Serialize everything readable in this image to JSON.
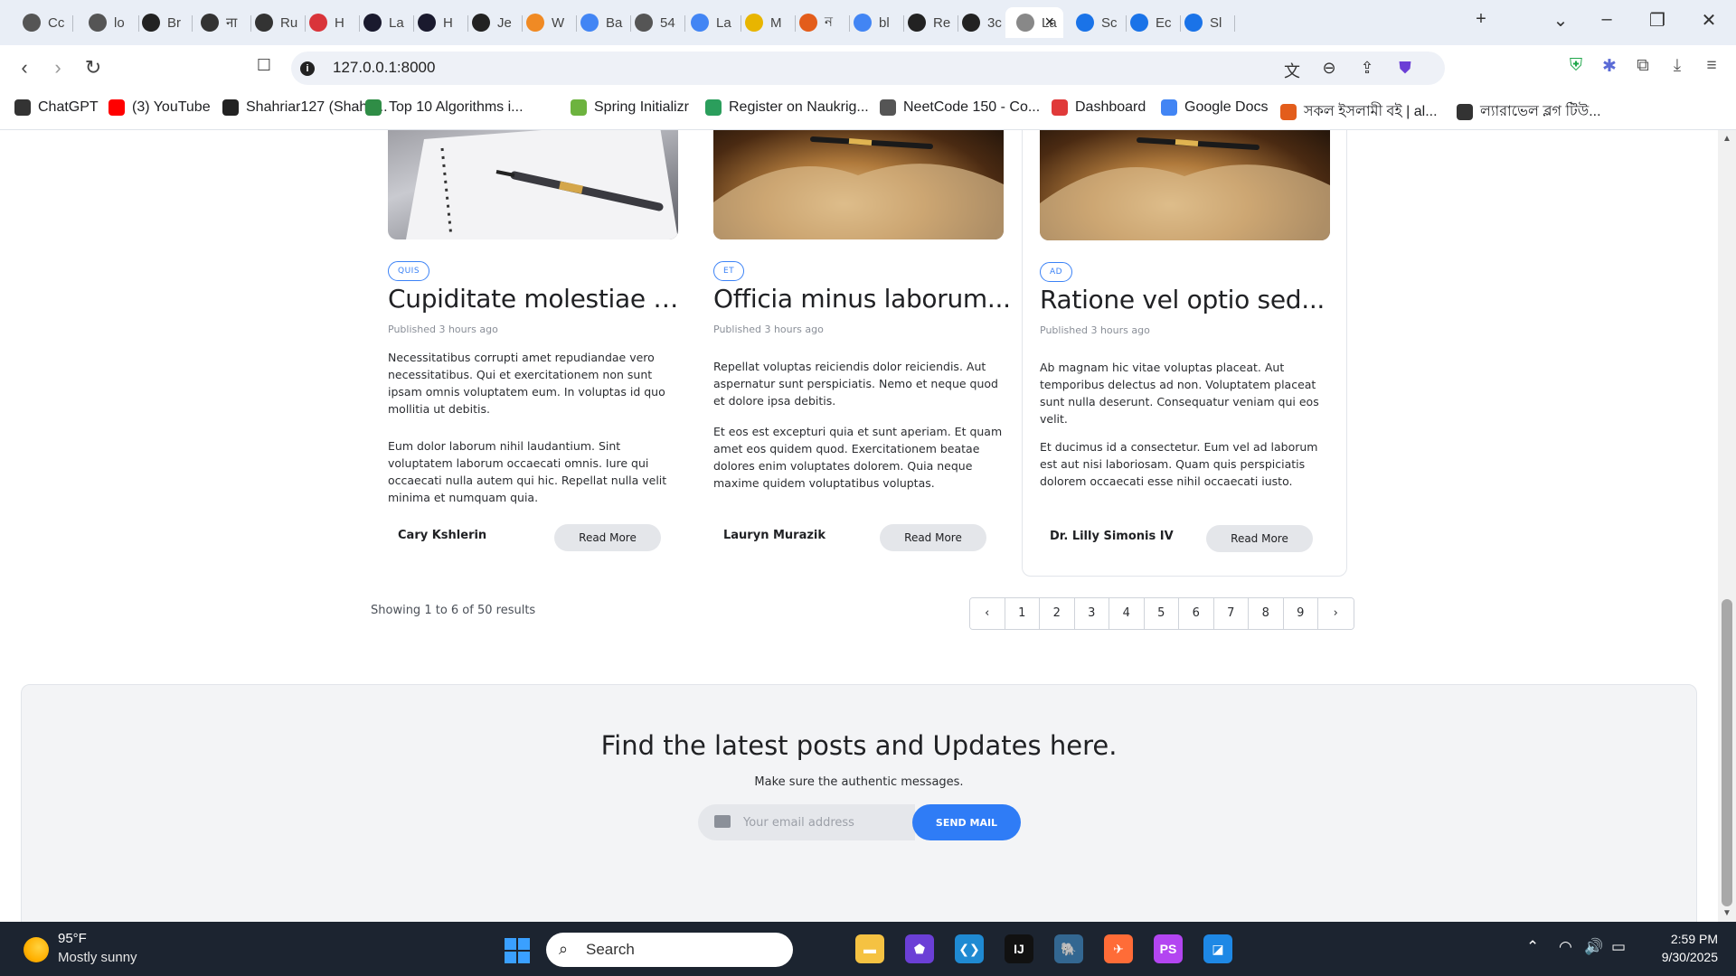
{
  "browser": {
    "tabs": [
      {
        "label": "Cc",
        "icon": "globe-icon",
        "color": "#555555"
      },
      {
        "label": "lo",
        "icon": "openai-icon",
        "color": "#555555"
      },
      {
        "label": "Br",
        "icon": "github-icon",
        "color": "#222222"
      },
      {
        "label": "ना",
        "icon": "openai-icon",
        "color": "#333333"
      },
      {
        "label": "Ru",
        "icon": "openai-icon",
        "color": "#333333"
      },
      {
        "label": "H",
        "icon": "nsu-icon",
        "color": "#d9343a"
      },
      {
        "label": "La",
        "icon": "atcoder-icon",
        "color": "#1a1a2e"
      },
      {
        "label": "H",
        "icon": "atcoder-icon",
        "color": "#1a1a2e"
      },
      {
        "label": "Je",
        "icon": "github-icon",
        "color": "#222222"
      },
      {
        "label": "W",
        "icon": "diamond-icon",
        "color": "#f08a24"
      },
      {
        "label": "Ba",
        "icon": "translate-icon",
        "color": "#4285f4"
      },
      {
        "label": "54",
        "icon": "globe-icon",
        "color": "#555555"
      },
      {
        "label": "La",
        "icon": "docs-icon",
        "color": "#4285f4"
      },
      {
        "label": "M",
        "icon": "medium-icon",
        "color": "#e8b500"
      },
      {
        "label": "ন",
        "icon": "a-icon",
        "color": "#e35d1b"
      },
      {
        "label": "bl",
        "icon": "google-icon",
        "color": "#4285f4"
      },
      {
        "label": "Re",
        "icon": "blocks-icon",
        "color": "#222222"
      },
      {
        "label": "3c",
        "icon": "s-icon",
        "color": "#222222"
      },
      {
        "label": "La",
        "icon": "page-icon",
        "color": "#888888",
        "active": true
      },
      {
        "label": "Sc",
        "icon": "forms-icon",
        "color": "#1a73e8"
      },
      {
        "label": "Ec",
        "icon": "forms-icon",
        "color": "#1a73e8"
      },
      {
        "label": "Sl",
        "icon": "forms-icon",
        "color": "#1a73e8"
      }
    ],
    "url": "127.0.0.1:8000",
    "bookmarks": [
      {
        "label": "ChatGPT",
        "icon": "openai-icon",
        "color": "#333333"
      },
      {
        "label": "(3) YouTube",
        "icon": "youtube-icon",
        "color": "#ff0000"
      },
      {
        "label": "Shahriar127 (Shahri...",
        "icon": "github-icon",
        "color": "#222222"
      },
      {
        "label": "Top 10 Algorithms i...",
        "icon": "gfg-icon",
        "color": "#2f8d46"
      },
      {
        "label": "Spring Initializr",
        "icon": "spring-icon",
        "color": "#6db33f"
      },
      {
        "label": "Register on Naukrig...",
        "icon": "naukri-icon",
        "color": "#2b9e5c"
      },
      {
        "label": "NeetCode 150 - Co...",
        "icon": "rocket-icon",
        "color": "#555555"
      },
      {
        "label": "Dashboard",
        "icon": "dashboard-icon",
        "color": "#e03a3a"
      },
      {
        "label": "Google Docs",
        "icon": "docs-icon",
        "color": "#4285f4"
      },
      {
        "label": "সকল ইসলামী বই | al...",
        "icon": "a-icon",
        "color": "#e35d1b"
      },
      {
        "label": "ল্যারাভেল ব্লগ টিউ...",
        "icon": "openai-icon",
        "color": "#333333"
      }
    ]
  },
  "page": {
    "cards": [
      {
        "image": "notebook-pen",
        "tag": "QUIS",
        "title": "Cupiditate molestiae e...",
        "published": "Published 3 hours ago",
        "paragraphs": [
          "Necessitatibus corrupti amet repudiandae vero necessitatibus. Qui et exercitationem non sunt ipsam omnis voluptatem eum. In voluptas id quo mollitia ut debitis.",
          "Eum dolor laborum nihil laudantium. Sint voluptatem laborum occaecati omnis. Iure qui occaecati nulla autem qui hic. Repellat nulla velit minima et numquam quia."
        ],
        "author": "Cary Kshlerin",
        "read_more": "Read More"
      },
      {
        "image": "open-book",
        "tag": "ET",
        "title": "Officia minus laborum...",
        "published": "Published 3 hours ago",
        "paragraphs": [
          "Repellat voluptas reiciendis dolor reiciendis. Aut aspernatur sunt perspiciatis. Nemo et neque quod et dolore ipsa debitis.",
          "Et eos est excepturi quia et sunt aperiam. Et quam amet eos quidem quod. Exercitationem beatae dolores enim voluptates dolorem. Quia neque maxime quidem voluptatibus voluptas."
        ],
        "author": "Lauryn Murazik",
        "read_more": "Read More"
      },
      {
        "image": "open-book",
        "tag": "AD",
        "title": "Ratione vel optio sed...",
        "published": "Published 3 hours ago",
        "paragraphs": [
          "Ab magnam hic vitae voluptas placeat. Aut temporibus delectus ad non. Voluptatem placeat sunt nulla deserunt. Consequatur veniam qui eos velit.",
          "Et ducimus id a consectetur. Eum vel ad laborum est aut nisi laboriosam. Quam quis perspiciatis dolorem occaecati esse nihil occaecati iusto."
        ],
        "author": "Dr. Lilly Simonis IV",
        "read_more": "Read More"
      }
    ],
    "results_text": "Showing 1 to 6 of 50 results",
    "pagination": {
      "prev": "‹",
      "pages": [
        "1",
        "2",
        "3",
        "4",
        "5",
        "6",
        "7",
        "8",
        "9"
      ],
      "next": "›"
    },
    "newsletter": {
      "title": "Find the latest posts and Updates here.",
      "subtitle": "Make sure the authentic messages.",
      "email_placeholder": "Your email address",
      "button": "SEND MAIL"
    },
    "accent_color": "#2f7cf6"
  },
  "taskbar": {
    "weather_temp": "95°F",
    "weather_desc": "Mostly sunny",
    "search_label": "Search",
    "apps": [
      {
        "name": "file-explorer-icon",
        "color": "#f5c242",
        "glyph": "▬"
      },
      {
        "name": "shield-app-icon",
        "color": "#6b3fd6",
        "glyph": "⬟"
      },
      {
        "name": "vscode-icon",
        "color": "#1f8ad2",
        "glyph": "❮❯"
      },
      {
        "name": "intellij-icon",
        "color": "#111111",
        "glyph": "IJ"
      },
      {
        "name": "postgres-icon",
        "color": "#336791",
        "glyph": "🐘"
      },
      {
        "name": "postman-icon",
        "color": "#ff6c37",
        "glyph": "✈"
      },
      {
        "name": "phpstorm-icon",
        "color": "#b345f1",
        "glyph": "PS"
      },
      {
        "name": "photos-icon",
        "color": "#1e88e5",
        "glyph": "◪"
      }
    ],
    "time": "2:59 PM",
    "date": "9/30/2025"
  }
}
